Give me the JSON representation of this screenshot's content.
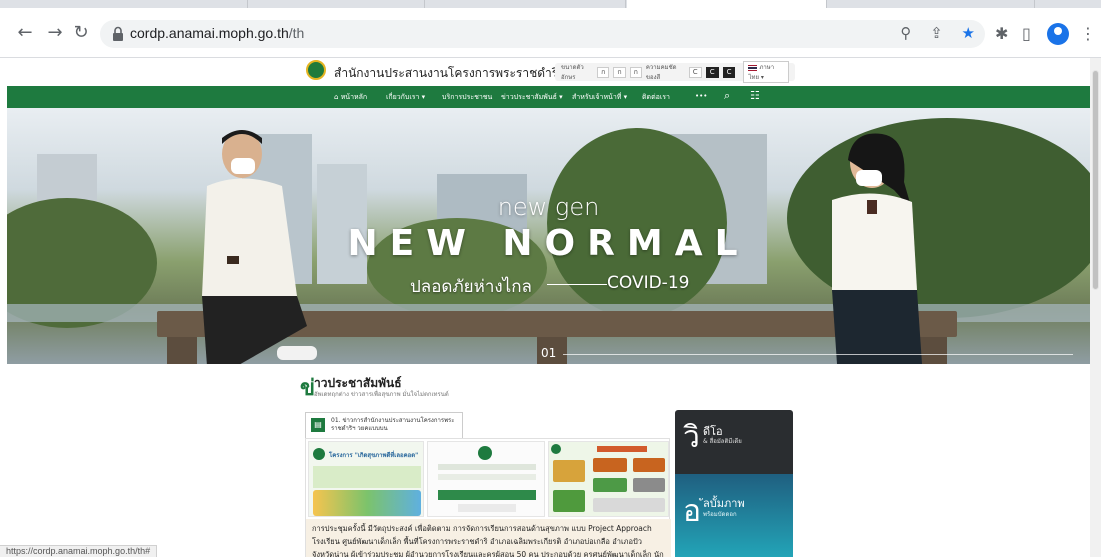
{
  "browser": {
    "url_host": "cordp.anamai.moph.go.th",
    "url_path": "/th",
    "status_url": "https://cordp.anamai.moph.go.th/th#"
  },
  "header": {
    "site_name": "สำนักงานประสานงานโครงการพระราชดำริฯ",
    "a11y_font_label": "ขนาดตัวอักษร",
    "a11y_font_buttons": [
      "ก",
      "ก",
      "ก"
    ],
    "a11y_contrast_label": "ความคมชัดของสี",
    "a11y_contrast_buttons": [
      "C",
      "C",
      "C"
    ],
    "language": "ภาษาไทย"
  },
  "nav": {
    "items": [
      "หน้าหลัก",
      "เกี่ยวกับเรา",
      "บริการประชาชน",
      "ข่าวประชาสัมพันธ์",
      "สำหรับเจ้าหน้าที่",
      "ติดต่อเรา"
    ],
    "more": "•••"
  },
  "hero": {
    "sub": "new gen",
    "main": "NEW NORMAL",
    "thai": "ปลอดภัยห่างไกล",
    "covid": "COVID-19",
    "slide": "01"
  },
  "news": {
    "big_letter": "ข่",
    "title": "าวประชาสัมพันธ์",
    "subtitle": "อัพเดทฤกต่าง ข่าวสารเพื่อสุขภาพ มั่นใจไม่ตกเทรนด์",
    "tab_icon": "▤",
    "tab_text": "01. ข่าวการสำนักงานประสานงานโครงการพระราชดำริฯ วยคแบบบน",
    "thumb1_title": "โครงการ \"เกิดสุขภาพดีที่เลอคอด\"",
    "body": "การประชุมครั้งนี้ มีวัตถุประสงค์ เพื่อติดตาม การจัดการเรียนการสอนด้านสุขภาพ แบบ Project Approach โรงเรียน ศูนย์พัฒนาเด็กเล็ก พื้นที่โครงการพระราชดำริ อำเภอเฉลิมพระเกียรติ อำเภอบ่อเกลือ อำเภอปัว จังหวัดน่าน ผู้เข้าร่วมประชุม ผู้อำนวยการโรงเรียนและครูผู้สอน 50 คน ประกอบด้วย ครูศูนย์พัฒนาเด็กเล็ก นักวิชาการ พยาบาล"
  },
  "side": {
    "tv_big": "วิ",
    "tv_title": "ดีโอ",
    "tv_sub": "& สื่อมัลติมีเดีย",
    "photo_big": "อ",
    "photo_title": "ัลบั้มภาพ",
    "photo_sub": "พร้อมบัดดอก"
  },
  "colors": {
    "brand_green": "#1e7a3f",
    "chrome_blue": "#1a73e8"
  }
}
